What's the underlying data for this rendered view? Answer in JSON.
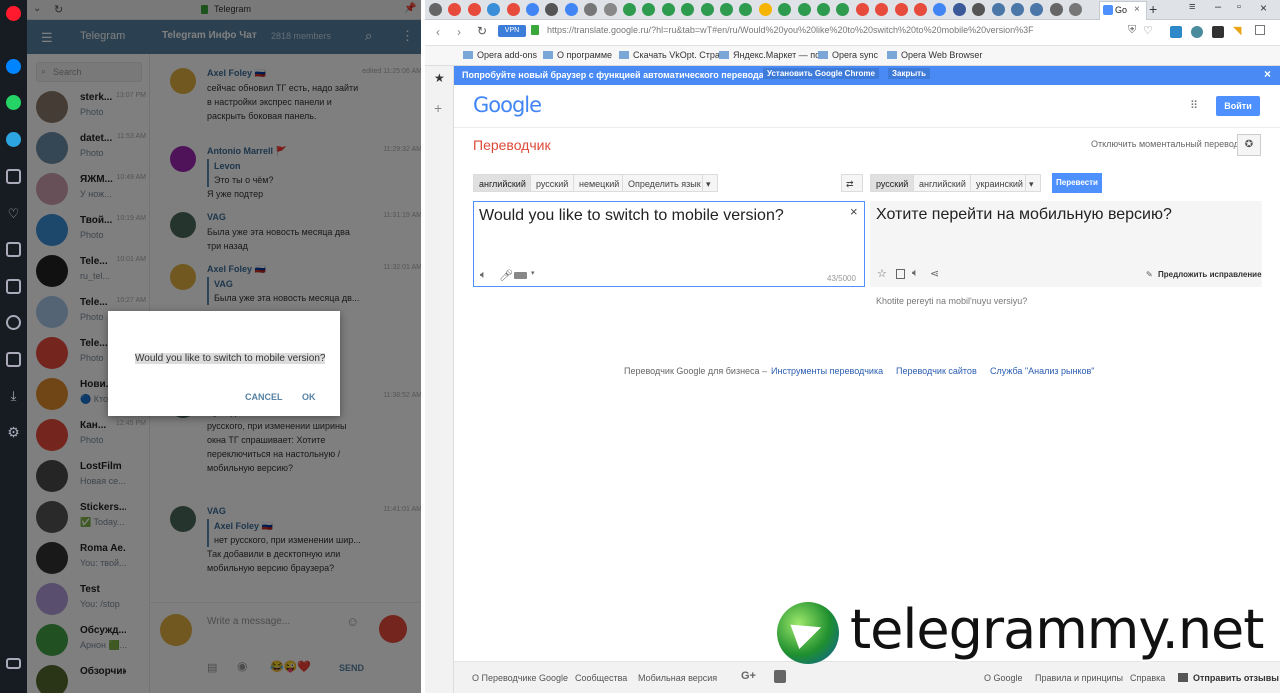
{
  "left_window": {
    "title": "Telegram",
    "header_app": "Telegram",
    "chat_title": "Telegram Инфо Чат",
    "members": "2818 members",
    "search_placeholder": "Search",
    "chats": [
      {
        "name": "sterk...",
        "preview": "Photo",
        "time": "13:07 PM",
        "color": "#8a7a6a"
      },
      {
        "name": "datet...",
        "preview": "Photo",
        "time": "11:53 AM",
        "color": "#6a8caa"
      },
      {
        "name": "ЯЖМ...",
        "preview": "У нож...",
        "time": "10:49 AM",
        "color": "#d0a0b0"
      },
      {
        "name": "Твой...",
        "preview": "Photo",
        "time": "10:19 AM",
        "color": "#3d8ed8"
      },
      {
        "name": "Tele...",
        "preview": "ru_tel...",
        "time": "10:01 AM",
        "color": "#222222"
      },
      {
        "name": "Tele...",
        "preview": "Photo",
        "time": "10:27 AM",
        "color": "#a9c8e8"
      },
      {
        "name": "Tele...",
        "preview": "Photo",
        "time": "",
        "color": "#e74b3c"
      },
      {
        "name": "Нови...",
        "preview": "🔵 Кто...",
        "time": "",
        "color": "#e08d2c"
      },
      {
        "name": "Кан...",
        "preview": "Photo",
        "time": "12:45 PM",
        "color": "#e74b3c"
      },
      {
        "name": "LostFilm",
        "preview": "Новая се...",
        "time": "",
        "color": "#4a4a4a"
      },
      {
        "name": "Stickers...",
        "preview": "✅ Today...",
        "time": "",
        "color": "#555555"
      },
      {
        "name": "Roma Ae...",
        "preview": "You: твой...",
        "time": "",
        "color": "#333333"
      },
      {
        "name": "Test",
        "preview": "You: /stop",
        "time": "",
        "color": "#b39ddb"
      },
      {
        "name": "Обсужд...",
        "preview": "Арнон 🟩...",
        "time": "",
        "color": "#43a047"
      },
      {
        "name": "Обзорчик",
        "preview": "",
        "time": "",
        "color": "#556b2f"
      }
    ],
    "messages": [
      {
        "author": "Axel Foley 🇷🇺",
        "text": "сейчас обновил ТГ есть, надо зайти в настройки экспрес панели и раскрыть боковая панель.",
        "time": "edited 11:25:06 AM",
        "color": "#e0b040"
      },
      {
        "author": "Antonio Marrell 🚩",
        "reply": "Levon",
        "text": "Это ты о чём?",
        "extra": "Я уже подтер",
        "time": "11:29:32 AM",
        "color": "#9c27b0"
      },
      {
        "author": "VAG",
        "text": "Была уже эта новость месяца два три назад",
        "time": "11:31:19 AM",
        "color": "#4a6b5a"
      },
      {
        "author": "Axel Foley 🇷🇺",
        "reply": "VAG",
        "text": "Была уже эта новость месяца дв...",
        "time": "11:32:01 AM",
        "color": "#e0b040"
      },
      {
        "author": "VAG",
        "reply": "",
        "text": "Ну ладно, я этого не знаю нет русского, при изменении ширины окна ТГ спрашивает: Хотите переключиться на настольную / мобильную версию?",
        "time": "11:38:52 AM",
        "color": "#4a6b5a"
      },
      {
        "author": "VAG",
        "reply": "Axel Foley 🇷🇺",
        "text": "нет русского, при изменении шир...",
        "extra": "Так добавили в десктопную или мобильную версию браузера?",
        "time": "11:41:01 AM",
        "color": "#4a6b5a"
      }
    ],
    "compose_placeholder": "Write a message...",
    "send_label": "SEND",
    "dialog": {
      "text": "Would you like to switch to mobile version?",
      "cancel": "CANCEL",
      "ok": "OK"
    }
  },
  "browser": {
    "tab_label": "Go",
    "url": "https://translate.google.ru/?hl=ru&tab=wT#en/ru/Would%20you%20like%20to%20switch%20to%20mobile%20version%3F",
    "bookmarks": [
      "Opera add-ons",
      "О программе",
      "Скачать VkOpt. Стра",
      "Яндекс.Маркет — по",
      "Opera sync",
      "Opera Web Browser"
    ],
    "notice": {
      "text": "Попробуйте новый браузер с функцией автоматического перевода.",
      "install": "Установить Google Chrome",
      "close": "Закрыть"
    }
  },
  "translate": {
    "logo": "Google",
    "signin": "Войти",
    "title": "Переводчик",
    "instant_off": "Отключить моментальный перевод",
    "src_langs": [
      "английский",
      "русский",
      "немецкий",
      "Определить язык"
    ],
    "dst_langs": [
      "русский",
      "английский",
      "украинский"
    ],
    "translate_button": "Перевести",
    "source_text": "Would you like to switch to mobile version?",
    "char_count": "43/5000",
    "result_text": "Хотите перейти на мобильную версию?",
    "suggest": "Предложить исправление",
    "transliteration": "Khotite pereyti na mobil'nuyu versiyu?",
    "business_prefix": "Переводчик Google для бизнеса –",
    "business_links": [
      "Инструменты переводчика",
      "Переводчик сайтов",
      "Служба \"Анализ рынков\""
    ],
    "footer_left": [
      "О Переводчике Google",
      "Сообщества",
      "Мобильная версия"
    ],
    "footer_right": [
      "О Google",
      "Правила и принципы",
      "Справка"
    ],
    "feedback": "Отправить отзывы"
  },
  "watermark": "telegrammy.net",
  "colors": {
    "telegram_blue": "#5682a3",
    "google_red": "#dd4b39",
    "google_blue": "#4d90fe",
    "opera_red": "#ff1b2d"
  }
}
